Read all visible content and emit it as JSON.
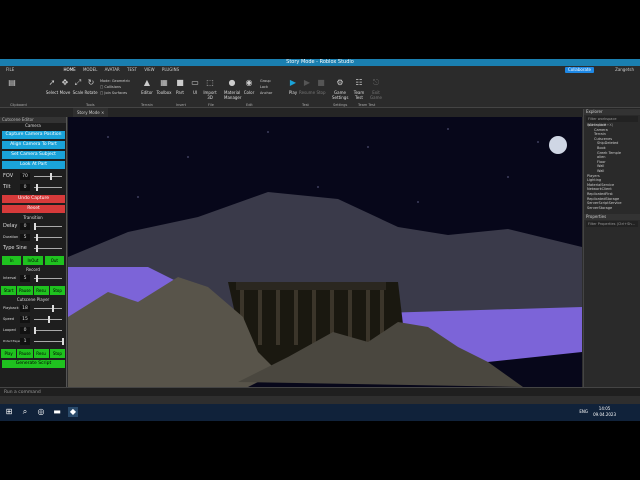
{
  "window": {
    "title": "Story Mode - Roblox Studio"
  },
  "menu": [
    "FILE",
    "HOME",
    "MODEL",
    "AVATAR",
    "TEST",
    "VIEW",
    "PLUGINS"
  ],
  "collaborate_label": "Collaborate",
  "username": "Zangetsh",
  "ribbon": {
    "tools": [
      "Select",
      "Move",
      "Scale",
      "Rotate"
    ],
    "mode_label": "Mode:",
    "mode_value": "Geometric",
    "collisions": "Collisions",
    "join_surfaces": "Join Surfaces",
    "terrain": [
      "Editor"
    ],
    "insert": [
      "Toolbox",
      "Part",
      "UI",
      "Import 3D"
    ],
    "edit": [
      "Material Manager",
      "Color",
      "Group",
      "Lock",
      "Anchor"
    ],
    "test": [
      "Play",
      "Resume",
      "Stop"
    ],
    "settings": [
      "Game Settings"
    ],
    "teamtest": [
      "Team Test",
      "Exit Game"
    ],
    "groups": [
      "Clipboard",
      "Tools",
      "Terrain",
      "Insert",
      "File",
      "Edit",
      "Test",
      "Settings",
      "Team Test"
    ]
  },
  "tabs": [
    "Story Mode"
  ],
  "left": {
    "header": "Cutscene Editor",
    "camera_title": "Camera",
    "capture": "Capture Camera Position",
    "align": "Align Camera To Part",
    "set_subject": "Set Camera Subject",
    "look_at": "Look At Part",
    "fov_label": "FOV",
    "fov": "70",
    "tilt_label": "Tilt",
    "tilt": "0",
    "undo": "Undo Capture",
    "reset": "Reset",
    "transition_title": "Transition",
    "delay_label": "Delay",
    "delay": "0",
    "duration_label": "Duration",
    "duration": "5",
    "type_label": "Type",
    "type": "Sine",
    "ease": [
      "In",
      "InOut",
      "Out"
    ],
    "record_title": "Record",
    "interval_label": "Interval",
    "interval": "5",
    "record_buttons": [
      "Start",
      "Pause",
      "Resu",
      "Stop"
    ],
    "player_title": "Cutscene Player",
    "playback_label": "Playback",
    "playback": "18",
    "speed_label": "Speed",
    "speed": "15",
    "looped_label": "Looped",
    "looped": "0",
    "prop_label": "Protect Player",
    "prop": "1",
    "player_buttons": [
      "Play",
      "Pause",
      "Resu",
      "Stop"
    ],
    "generate": "Generate Script"
  },
  "explorer": {
    "title": "Explorer",
    "filter": "Filter workspace (Ctrl+Shift+X)",
    "items": [
      "Workspace",
      "Camera",
      "Terrain",
      "Cutscenes",
      "ShipDeleted",
      "Book",
      "Greek Temple",
      "alien",
      "Floor",
      "Wall",
      "Wall",
      "Players",
      "Lighting",
      "MaterialService",
      "NetworkClient",
      "ReplicatedFirst",
      "ReplicatedStorage",
      "ServerScriptService",
      "ServerStorage"
    ]
  },
  "properties": {
    "title": "Properties",
    "filter": "Filter Properties (Ctrl+Sh..."
  },
  "command": {
    "placeholder": "Run a command"
  },
  "clock": {
    "time": "14:05",
    "date": "09.04.2023"
  },
  "language": "ENG",
  "colors": {
    "accent": "#1aa3d9",
    "terrain_water": "#7c64d8",
    "green": "#1fc21f",
    "red": "#d63a3a"
  }
}
